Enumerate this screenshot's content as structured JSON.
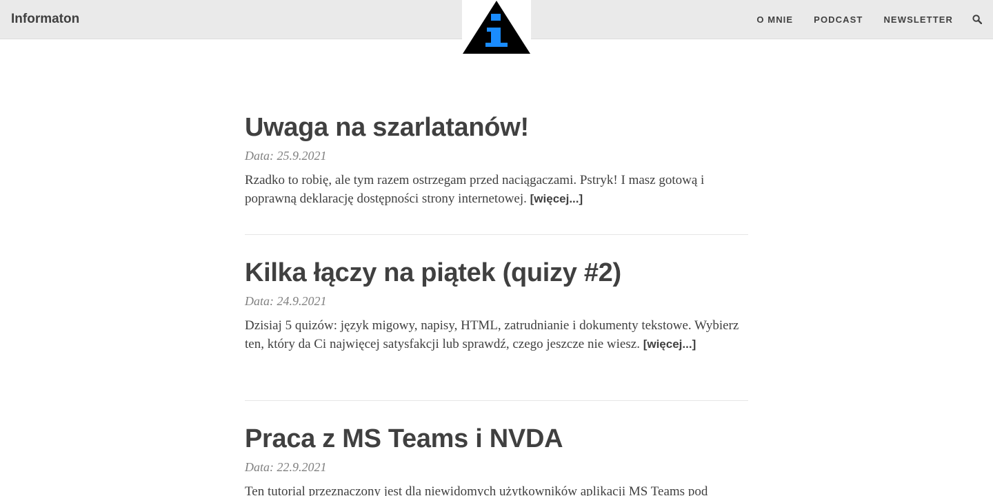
{
  "header": {
    "brand": "Informaton",
    "logo_icon": "info-triangle-logo",
    "nav": [
      {
        "label": "O MNIE"
      },
      {
        "label": "PODCAST"
      },
      {
        "label": "NEWSLETTER"
      }
    ],
    "search_icon": "search-icon"
  },
  "colors": {
    "navbar_bg": "#eaeaea",
    "text": "#404040",
    "date": "#808080",
    "logo_accent": "#1a8cff"
  },
  "posts": [
    {
      "title": "Uwaga na szarlatanów!",
      "date": "Data: 25.9.2021",
      "excerpt": "Rzadko to robię, ale tym razem ostrzegam przed naciągaczami. Pstryk! I masz gotową i poprawną deklarację dostępności strony internetowej.",
      "more": "[więcej...]"
    },
    {
      "title": "Kilka łączy na piątek (quizy #2)",
      "date": "Data: 24.9.2021",
      "excerpt": "Dzisiaj 5 quizów: język migowy, napisy, HTML, zatrudnianie i dokumenty tekstowe. Wybierz ten, który da Ci najwięcej satysfakcji lub sprawdź, czego jeszcze nie wiesz.",
      "more": "[więcej...]"
    },
    {
      "title": "Praca z MS Teams i NVDA",
      "date": "Data: 22.9.2021",
      "excerpt": "Ten tutorial przeznaczony jest dla niewidomych użytkowników aplikacji MS Teams pod"
    }
  ]
}
